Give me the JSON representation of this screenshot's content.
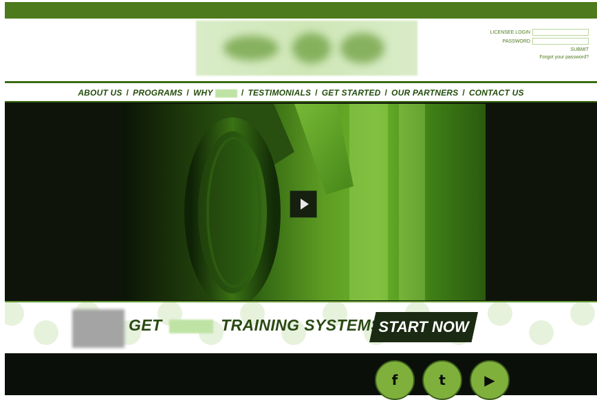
{
  "login": {
    "username_label": "LICENSEE LOGIN",
    "password_label": "PASSWORD",
    "submit_label": "SUBMIT",
    "forgot_label": "Forgot your password?"
  },
  "nav": {
    "items": [
      {
        "label": "ABOUT US"
      },
      {
        "label": "PROGRAMS"
      },
      {
        "label": "WHY"
      },
      {
        "label": "TESTIMONIALS"
      },
      {
        "label": "GET STARTED"
      },
      {
        "label": "OUR PARTNERS"
      },
      {
        "label": "CONTACT US"
      }
    ],
    "separator": "/"
  },
  "banner": {
    "get_label": "GET",
    "tail_label": "TRAINING SYSTEMS.",
    "cta_label": "START NOW"
  },
  "social": {
    "items": [
      {
        "name": "facebook-icon",
        "glyph": "f"
      },
      {
        "name": "twitter-icon",
        "glyph": "t"
      },
      {
        "name": "youtube-icon",
        "glyph": "▶"
      }
    ]
  },
  "colors": {
    "top_bar": "#4d7a1d",
    "nav_text": "#234d0c",
    "accent": "#6aa03b",
    "dark": "#0b0f09"
  }
}
